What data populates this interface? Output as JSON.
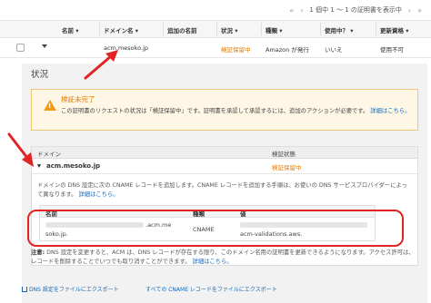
{
  "pager": {
    "first": "«",
    "prev": "‹",
    "text": "1 個中 1 ～ 1 の証明書を表示中",
    "next": "›",
    "last": "»"
  },
  "columns": {
    "name": "名前",
    "domain": "ドメイン名",
    "additional": "追加の名前",
    "status": "状況",
    "type": "種類",
    "in_use": "使用中？",
    "renewal": "更新資格"
  },
  "row": {
    "domain": "acm.mesoko.jp",
    "status": "検証保留中",
    "type": "Amazon が発行",
    "in_use": "いいえ",
    "renewal": "使用不可"
  },
  "panel": {
    "title": "状況",
    "alert_title": "検証未完了",
    "alert_body": "この証明書のリクエストの状況は「検証保留中」です。証明書を承認して承認するには、追加のアクションが必要です。",
    "alert_link": "詳細はこちら。"
  },
  "domain_table": {
    "col_domain": "ドメイン",
    "col_status": "検証状態",
    "domain": "acm.mesoko.jp",
    "status": "検証保留中",
    "description": "ドメインの DNS 設定に次の CNAME レコードを追加します。CNAME レコードを追加する手順は、お使いの DNS サービスプロバイダーによって異なります。",
    "description_link": "詳細はこちら。"
  },
  "cname": {
    "col_name": "名前",
    "col_type": "種類",
    "col_value": "値",
    "name_line1": ".acm.me",
    "name_line2": "soko.jp.",
    "type": "CNAME",
    "value_line2": "acm-validations.aws."
  },
  "note": {
    "label": "注意:",
    "text": "DNS 設定を変更すると、ACM は、DNS レコードが存在する限り、このドメイン名用の証明書を更新できるようになります。アクセス許可は、レコードを削除することでいつでも取り消すことができます。",
    "link": "詳細はこちら。"
  },
  "exports": {
    "dns": "DNS 設定をファイルにエクスポート",
    "all": "すべての CNAME レコードをファイルにエクスポート"
  },
  "colors": {
    "warning": "#e07b00",
    "link": "#1166bb",
    "annotation": "#e02424"
  }
}
